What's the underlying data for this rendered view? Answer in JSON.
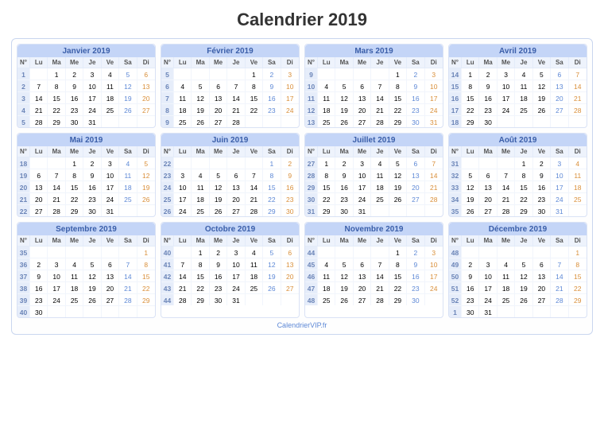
{
  "title": "Calendrier 2019",
  "footer": "CalendrierVIP.fr",
  "day_headers": [
    "N°",
    "Lu",
    "Ma",
    "Me",
    "Je",
    "Ve",
    "Sa",
    "Di"
  ],
  "months": [
    {
      "name": "Janvier 2019",
      "weeks": [
        {
          "n": 1,
          "d": [
            "",
            "1",
            "2",
            "3",
            "4",
            "5",
            "6"
          ]
        },
        {
          "n": 2,
          "d": [
            "7",
            "8",
            "9",
            "10",
            "11",
            "12",
            "13"
          ]
        },
        {
          "n": 3,
          "d": [
            "14",
            "15",
            "16",
            "17",
            "18",
            "19",
            "20"
          ]
        },
        {
          "n": 4,
          "d": [
            "21",
            "22",
            "23",
            "24",
            "25",
            "26",
            "27"
          ]
        },
        {
          "n": 5,
          "d": [
            "28",
            "29",
            "30",
            "31",
            "",
            "",
            ""
          ]
        }
      ]
    },
    {
      "name": "Février 2019",
      "weeks": [
        {
          "n": 5,
          "d": [
            "",
            "",
            "",
            "",
            "1",
            "2",
            "3"
          ]
        },
        {
          "n": 6,
          "d": [
            "4",
            "5",
            "6",
            "7",
            "8",
            "9",
            "10"
          ]
        },
        {
          "n": 7,
          "d": [
            "11",
            "12",
            "13",
            "14",
            "15",
            "16",
            "17"
          ]
        },
        {
          "n": 8,
          "d": [
            "18",
            "19",
            "20",
            "21",
            "22",
            "23",
            "24"
          ]
        },
        {
          "n": 9,
          "d": [
            "25",
            "26",
            "27",
            "28",
            "",
            "",
            ""
          ]
        }
      ]
    },
    {
      "name": "Mars 2019",
      "weeks": [
        {
          "n": 9,
          "d": [
            "",
            "",
            "",
            "",
            "1",
            "2",
            "3"
          ]
        },
        {
          "n": 10,
          "d": [
            "4",
            "5",
            "6",
            "7",
            "8",
            "9",
            "10"
          ]
        },
        {
          "n": 11,
          "d": [
            "11",
            "12",
            "13",
            "14",
            "15",
            "16",
            "17"
          ]
        },
        {
          "n": 12,
          "d": [
            "18",
            "19",
            "20",
            "21",
            "22",
            "23",
            "24"
          ]
        },
        {
          "n": 13,
          "d": [
            "25",
            "26",
            "27",
            "28",
            "29",
            "30",
            "31"
          ]
        }
      ]
    },
    {
      "name": "Avril 2019",
      "weeks": [
        {
          "n": 14,
          "d": [
            "1",
            "2",
            "3",
            "4",
            "5",
            "6",
            "7"
          ]
        },
        {
          "n": 15,
          "d": [
            "8",
            "9",
            "10",
            "11",
            "12",
            "13",
            "14"
          ]
        },
        {
          "n": 16,
          "d": [
            "15",
            "16",
            "17",
            "18",
            "19",
            "20",
            "21"
          ]
        },
        {
          "n": 17,
          "d": [
            "22",
            "23",
            "24",
            "25",
            "26",
            "27",
            "28"
          ]
        },
        {
          "n": 18,
          "d": [
            "29",
            "30",
            "",
            "",
            "",
            "",
            ""
          ]
        }
      ]
    },
    {
      "name": "Mai 2019",
      "weeks": [
        {
          "n": 18,
          "d": [
            "",
            "",
            "1",
            "2",
            "3",
            "4",
            "5"
          ]
        },
        {
          "n": 19,
          "d": [
            "6",
            "7",
            "8",
            "9",
            "10",
            "11",
            "12"
          ]
        },
        {
          "n": 20,
          "d": [
            "13",
            "14",
            "15",
            "16",
            "17",
            "18",
            "19"
          ]
        },
        {
          "n": 21,
          "d": [
            "20",
            "21",
            "22",
            "23",
            "24",
            "25",
            "26"
          ]
        },
        {
          "n": 22,
          "d": [
            "27",
            "28",
            "29",
            "30",
            "31",
            "",
            ""
          ]
        }
      ]
    },
    {
      "name": "Juin 2019",
      "weeks": [
        {
          "n": 22,
          "d": [
            "",
            "",
            "",
            "",
            "",
            "1",
            "2"
          ]
        },
        {
          "n": 23,
          "d": [
            "3",
            "4",
            "5",
            "6",
            "7",
            "8",
            "9"
          ]
        },
        {
          "n": 24,
          "d": [
            "10",
            "11",
            "12",
            "13",
            "14",
            "15",
            "16"
          ]
        },
        {
          "n": 25,
          "d": [
            "17",
            "18",
            "19",
            "20",
            "21",
            "22",
            "23"
          ]
        },
        {
          "n": 26,
          "d": [
            "24",
            "25",
            "26",
            "27",
            "28",
            "29",
            "30"
          ]
        }
      ]
    },
    {
      "name": "Juillet 2019",
      "weeks": [
        {
          "n": 27,
          "d": [
            "1",
            "2",
            "3",
            "4",
            "5",
            "6",
            "7"
          ]
        },
        {
          "n": 28,
          "d": [
            "8",
            "9",
            "10",
            "11",
            "12",
            "13",
            "14"
          ]
        },
        {
          "n": 29,
          "d": [
            "15",
            "16",
            "17",
            "18",
            "19",
            "20",
            "21"
          ]
        },
        {
          "n": 30,
          "d": [
            "22",
            "23",
            "24",
            "25",
            "26",
            "27",
            "28"
          ]
        },
        {
          "n": 31,
          "d": [
            "29",
            "30",
            "31",
            "",
            "",
            "",
            ""
          ]
        }
      ]
    },
    {
      "name": "Août 2019",
      "weeks": [
        {
          "n": 31,
          "d": [
            "",
            "",
            "",
            "1",
            "2",
            "3",
            "4"
          ]
        },
        {
          "n": 32,
          "d": [
            "5",
            "6",
            "7",
            "8",
            "9",
            "10",
            "11"
          ]
        },
        {
          "n": 33,
          "d": [
            "12",
            "13",
            "14",
            "15",
            "16",
            "17",
            "18"
          ]
        },
        {
          "n": 34,
          "d": [
            "19",
            "20",
            "21",
            "22",
            "23",
            "24",
            "25"
          ]
        },
        {
          "n": 35,
          "d": [
            "26",
            "27",
            "28",
            "29",
            "30",
            "31",
            ""
          ]
        }
      ]
    },
    {
      "name": "Septembre 2019",
      "weeks": [
        {
          "n": 35,
          "d": [
            "",
            "",
            "",
            "",
            "",
            "",
            "1"
          ]
        },
        {
          "n": 36,
          "d": [
            "2",
            "3",
            "4",
            "5",
            "6",
            "7",
            "8"
          ]
        },
        {
          "n": 37,
          "d": [
            "9",
            "10",
            "11",
            "12",
            "13",
            "14",
            "15"
          ]
        },
        {
          "n": 38,
          "d": [
            "16",
            "17",
            "18",
            "19",
            "20",
            "21",
            "22"
          ]
        },
        {
          "n": 39,
          "d": [
            "23",
            "24",
            "25",
            "26",
            "27",
            "28",
            "29"
          ]
        },
        {
          "n": 40,
          "d": [
            "30",
            "",
            "",
            "",
            "",
            "",
            ""
          ]
        }
      ]
    },
    {
      "name": "Octobre 2019",
      "weeks": [
        {
          "n": 40,
          "d": [
            "",
            "1",
            "2",
            "3",
            "4",
            "5",
            "6"
          ]
        },
        {
          "n": 41,
          "d": [
            "7",
            "8",
            "9",
            "10",
            "11",
            "12",
            "13"
          ]
        },
        {
          "n": 42,
          "d": [
            "14",
            "15",
            "16",
            "17",
            "18",
            "19",
            "20"
          ]
        },
        {
          "n": 43,
          "d": [
            "21",
            "22",
            "23",
            "24",
            "25",
            "26",
            "27"
          ]
        },
        {
          "n": 44,
          "d": [
            "28",
            "29",
            "30",
            "31",
            "",
            "",
            ""
          ]
        }
      ]
    },
    {
      "name": "Novembre 2019",
      "weeks": [
        {
          "n": 44,
          "d": [
            "",
            "",
            "",
            "",
            "1",
            "2",
            "3"
          ]
        },
        {
          "n": 45,
          "d": [
            "4",
            "5",
            "6",
            "7",
            "8",
            "9",
            "10"
          ]
        },
        {
          "n": 46,
          "d": [
            "11",
            "12",
            "13",
            "14",
            "15",
            "16",
            "17"
          ]
        },
        {
          "n": 47,
          "d": [
            "18",
            "19",
            "20",
            "21",
            "22",
            "23",
            "24"
          ]
        },
        {
          "n": 48,
          "d": [
            "25",
            "26",
            "27",
            "28",
            "29",
            "30",
            ""
          ]
        }
      ]
    },
    {
      "name": "Décembre 2019",
      "weeks": [
        {
          "n": 48,
          "d": [
            "",
            "",
            "",
            "",
            "",
            "",
            "1"
          ]
        },
        {
          "n": 49,
          "d": [
            "2",
            "3",
            "4",
            "5",
            "6",
            "7",
            "8"
          ]
        },
        {
          "n": 50,
          "d": [
            "9",
            "10",
            "11",
            "12",
            "13",
            "14",
            "15"
          ]
        },
        {
          "n": 51,
          "d": [
            "16",
            "17",
            "18",
            "19",
            "20",
            "21",
            "22"
          ]
        },
        {
          "n": 52,
          "d": [
            "23",
            "24",
            "25",
            "26",
            "27",
            "28",
            "29"
          ]
        },
        {
          "n": 1,
          "d": [
            "30",
            "31",
            "",
            "",
            "",
            "",
            ""
          ]
        }
      ]
    }
  ]
}
